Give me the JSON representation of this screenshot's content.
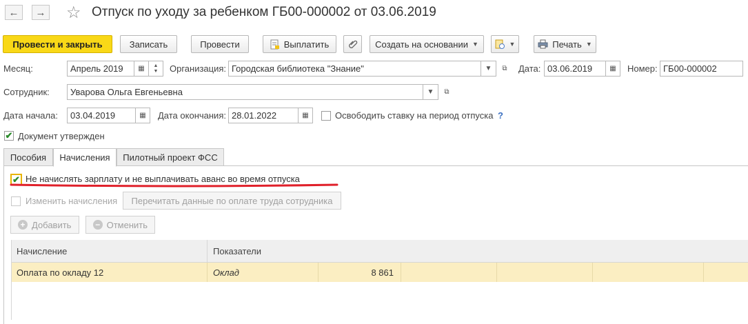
{
  "header": {
    "title": "Отпуск по уходу за ребенком ГБ00-000002 от 03.06.2019",
    "back_icon": "←",
    "forward_icon": "→",
    "star_icon": "☆"
  },
  "toolbar": {
    "post_close": "Провести и закрыть",
    "save": "Записать",
    "post": "Провести",
    "pay": "Выплатить",
    "create_based": "Создать на основании",
    "print": "Печать"
  },
  "form": {
    "month_label": "Месяц:",
    "month_value": "Апрель 2019",
    "org_label": "Организация:",
    "org_value": "Городская библиотека \"Знание\"",
    "date_label": "Дата:",
    "date_value": "03.06.2019",
    "number_label": "Номер:",
    "number_value": "ГБ00-000002",
    "employee_label": "Сотрудник:",
    "employee_value": "Уварова Ольга Евгеньевна",
    "start_label": "Дата начала:",
    "start_value": "03.04.2019",
    "end_label": "Дата окончания:",
    "end_value": "28.01.2022",
    "free_rate_label": "Освободить ставку на период отпуска",
    "help_mark": "?",
    "approved_label": "Документ утвержден"
  },
  "tabs": [
    "Пособия",
    "Начисления",
    "Пилотный проект ФСС"
  ],
  "accruals": {
    "no_salary_label": "Не начислять зарплату и не выплачивать аванс во время отпуска",
    "change_label": "Изменить начисления",
    "reread_label": "Перечитать данные по оплате труда сотрудника",
    "add_label": "Добавить",
    "cancel_label": "Отменить",
    "columns": [
      "Начисление",
      "Показатели"
    ],
    "rows": [
      {
        "name": "Оплата по окладу 12",
        "indicator": "Оклад",
        "value": "8 861"
      }
    ]
  },
  "colors": {
    "primary_button": "#f9d817",
    "selected_row": "#fbeec2",
    "check_green": "#2a8a2a",
    "annotation_red": "#e0202a"
  }
}
